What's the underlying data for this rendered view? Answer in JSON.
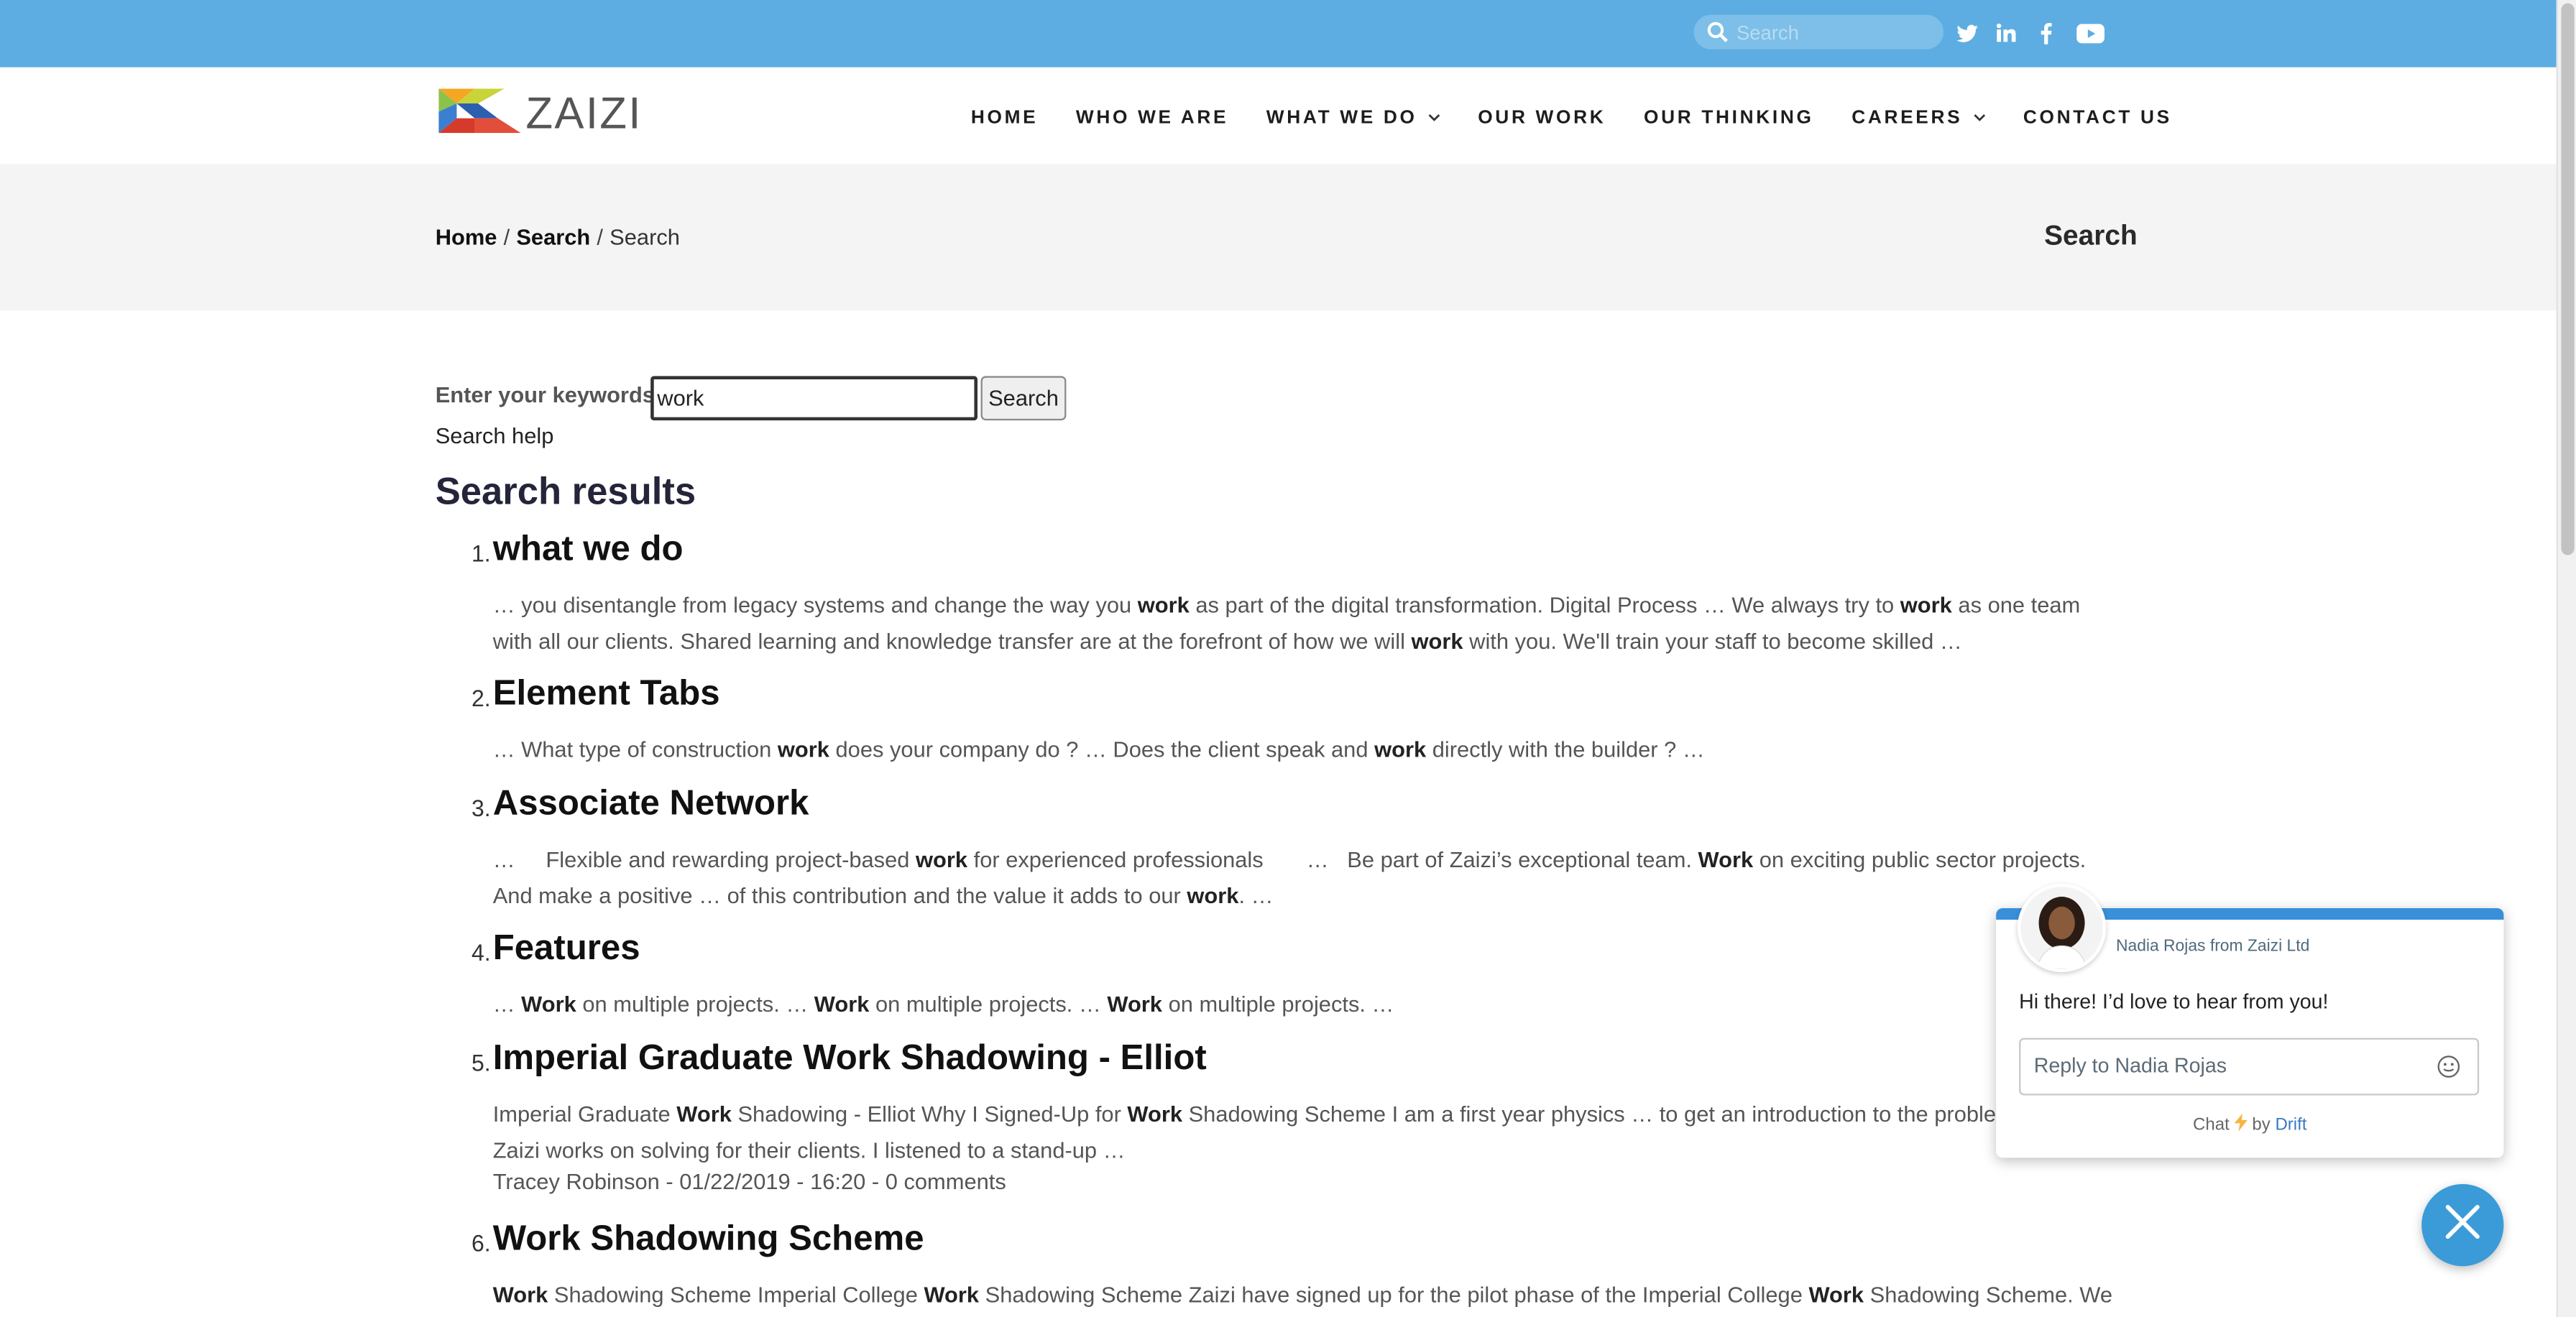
{
  "topbar": {
    "search_placeholder": "Search",
    "social": [
      "twitter-icon",
      "linkedin-icon",
      "facebook-icon",
      "youtube-icon"
    ],
    "bg_color": "#5dade2"
  },
  "header": {
    "logo_text": "ZAIZI",
    "nav": [
      {
        "label": "HOME",
        "dropdown": false
      },
      {
        "label": "WHO WE ARE",
        "dropdown": false
      },
      {
        "label": "WHAT WE DO",
        "dropdown": true
      },
      {
        "label": "OUR WORK",
        "dropdown": false
      },
      {
        "label": "OUR THINKING",
        "dropdown": false
      },
      {
        "label": "CAREERS",
        "dropdown": true
      },
      {
        "label": "CONTACT US",
        "dropdown": false
      }
    ]
  },
  "breadcrumb": {
    "home": "Home",
    "search": "Search",
    "current": "Search",
    "separator": "/",
    "title": "Search"
  },
  "search_form": {
    "label": "Enter your keywords",
    "value": "work",
    "button": "Search",
    "help": "Search help"
  },
  "results": {
    "title": "Search results",
    "items": [
      {
        "num": "1.",
        "title": "what we do",
        "snippet_html": "… you disentangle from legacy systems and change the way you <b>work</b> as part of the digital transformation. Digital Process … We always try to <b>work</b> as one team with all our clients. Shared learning and knowledge transfer are at the forefront of how we will <b>work</b> with you. We'll train your staff to become skilled …"
      },
      {
        "num": "2.",
        "title": "Element Tabs",
        "snippet_html": "… What type of construction <b>work</b> does your company do ? … Does the client speak and <b>work</b> directly with the builder ? …"
      },
      {
        "num": "3.",
        "title": "Associate Network",
        "snippet_html": "…&nbsp;&nbsp;&nbsp;&nbsp; Flexible and rewarding project-based <b>work</b> for experienced professionals &nbsp;&nbsp;&nbsp;&nbsp;&nbsp; …&nbsp;&nbsp; Be part of Zaizi’s exceptional team. <b>Work</b> on exciting public sector projects. And make a positive … of this contribution and the value it adds to our <b>work</b>. …"
      },
      {
        "num": "4.",
        "title": "Features",
        "snippet_html": "… <b>Work</b> on multiple projects. … <b>Work</b> on multiple projects. … <b>Work</b> on multiple projects. …"
      },
      {
        "num": "5.",
        "title": "Imperial Graduate Work Shadowing - Elliot",
        "snippet_html": "Imperial Graduate <b>Work</b> Shadowing - Elliot Why I Signed-Up for <b>Work</b> Shadowing Scheme I am a first year physics … to get an introduction to the problems that Zaizi works on solving for their clients. I listened to a stand-up …",
        "meta": "Tracey Robinson - 01/22/2019 - 16:20 - 0 comments"
      },
      {
        "num": "6.",
        "title": "Work Shadowing Scheme",
        "snippet_html": "<b>Work</b> Shadowing Scheme Imperial College <b>Work</b> Shadowing Scheme Zaizi have signed up for the pilot phase of the Imperial College <b>Work</b> Shadowing Scheme. We will host"
      }
    ]
  },
  "chat": {
    "from": "Nadia Rojas from Zaizi Ltd",
    "greeting": "Hi there! I’d love to hear from you!",
    "reply_placeholder": "Reply to Nadia Rojas",
    "powered_prefix": "Chat",
    "powered_by": "by",
    "powered_brand": "Drift",
    "accent": "#3a8fd9"
  }
}
